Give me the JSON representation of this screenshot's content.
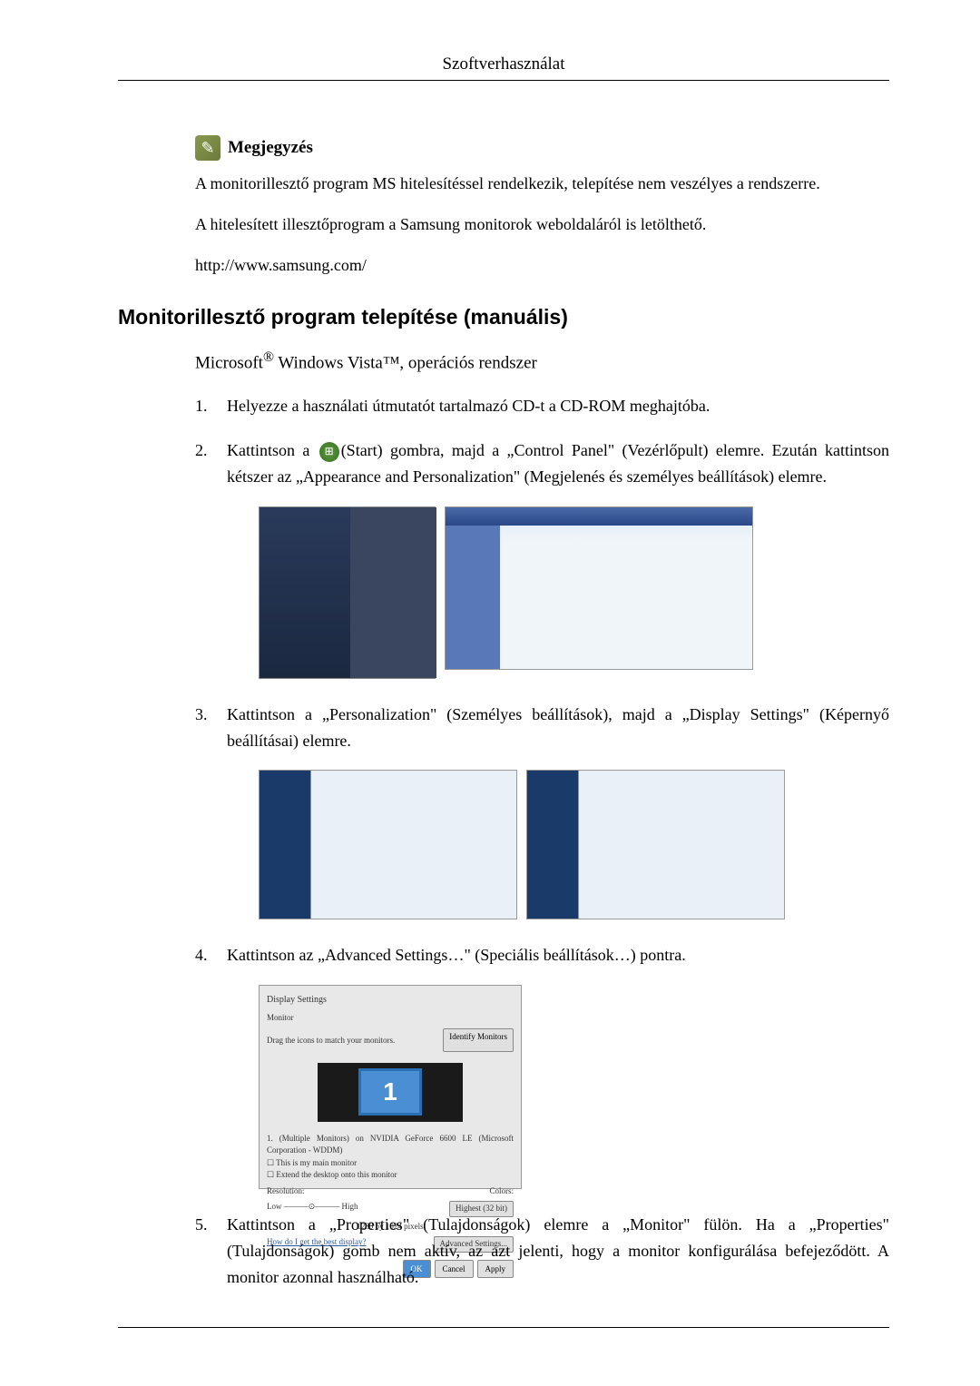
{
  "header": {
    "title": "Szoftverhasználat"
  },
  "note": {
    "title": "Megjegyzés",
    "paragraphs": [
      "A monitorillesztő program MS hitelesítéssel rendelkezik, telepítése nem veszélyes a rendszerre.",
      "A hitelesített illesztőprogram a Samsung monitorok weboldaláról is letölthető.",
      "http://www.samsung.com/"
    ]
  },
  "section": {
    "title": "Monitorillesztő program telepítése (manuális)",
    "subtitle_prefix": "Microsoft",
    "subtitle_suffix": " Windows Vista™, operációs rendszer",
    "steps": {
      "1": "Helyezze a használati útmutatót tartalmazó CD-t a CD-ROM meghajtóba.",
      "2_before": "Kattintson a ",
      "2_after": "(Start) gombra, majd a „Control Panel\" (Vezérlőpult) elemre. Ezután kattintson kétszer az „Appearance and Personalization\" (Megjelenés és személyes beállítások) elemre.",
      "3": "Kattintson a „Personalization\" (Személyes beállítások), majd a „Display Settings\" (Képernyő beállításai) elemre.",
      "4": "Kattintson az „Advanced Settings…\" (Speciális beállítások…) pontra.",
      "5": "Kattintson a „Properties\" (Tulajdonságok) elemre a „Monitor\" fülön. Ha a „Properties\" (Tulajdonságok) gomb nem aktív, az azt jelenti, hogy a monitor konfigurálása befejeződött. A monitor azonnal használható."
    }
  },
  "display_dialog": {
    "title": "Display Settings",
    "tab": "Monitor",
    "drag_text": "Drag the icons to match your monitors.",
    "identify_btn": "Identify Monitors",
    "monitor_number": "1",
    "monitor_label": "1. (Multiple Monitors) on NVIDIA GeForce 6600 LE (Microsoft Corporation - WDDM)",
    "checkbox1": "This is my main monitor",
    "checkbox2": "Extend the desktop onto this monitor",
    "resolution_label": "Resolution:",
    "low": "Low",
    "high": "High",
    "resolution_value": "1280 by 1024 pixels",
    "colors_label": "Colors:",
    "colors_value": "Highest (32 bit)",
    "help_link": "How do I get the best display?",
    "advanced_btn": "Advanced Settings...",
    "ok_btn": "OK",
    "cancel_btn": "Cancel",
    "apply_btn": "Apply"
  }
}
